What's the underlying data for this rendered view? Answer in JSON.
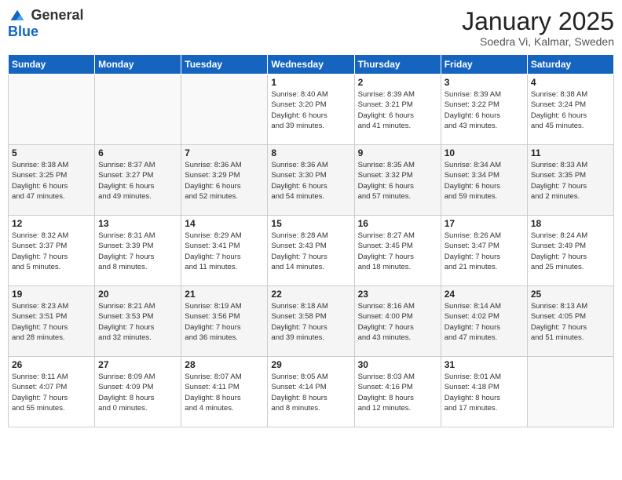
{
  "logo": {
    "general": "General",
    "blue": "Blue"
  },
  "title": "January 2025",
  "subtitle": "Soedra Vi, Kalmar, Sweden",
  "weekdays": [
    "Sunday",
    "Monday",
    "Tuesday",
    "Wednesday",
    "Thursday",
    "Friday",
    "Saturday"
  ],
  "weeks": [
    [
      {
        "day": "",
        "info": ""
      },
      {
        "day": "",
        "info": ""
      },
      {
        "day": "",
        "info": ""
      },
      {
        "day": "1",
        "info": "Sunrise: 8:40 AM\nSunset: 3:20 PM\nDaylight: 6 hours\nand 39 minutes."
      },
      {
        "day": "2",
        "info": "Sunrise: 8:39 AM\nSunset: 3:21 PM\nDaylight: 6 hours\nand 41 minutes."
      },
      {
        "day": "3",
        "info": "Sunrise: 8:39 AM\nSunset: 3:22 PM\nDaylight: 6 hours\nand 43 minutes."
      },
      {
        "day": "4",
        "info": "Sunrise: 8:38 AM\nSunset: 3:24 PM\nDaylight: 6 hours\nand 45 minutes."
      }
    ],
    [
      {
        "day": "5",
        "info": "Sunrise: 8:38 AM\nSunset: 3:25 PM\nDaylight: 6 hours\nand 47 minutes."
      },
      {
        "day": "6",
        "info": "Sunrise: 8:37 AM\nSunset: 3:27 PM\nDaylight: 6 hours\nand 49 minutes."
      },
      {
        "day": "7",
        "info": "Sunrise: 8:36 AM\nSunset: 3:29 PM\nDaylight: 6 hours\nand 52 minutes."
      },
      {
        "day": "8",
        "info": "Sunrise: 8:36 AM\nSunset: 3:30 PM\nDaylight: 6 hours\nand 54 minutes."
      },
      {
        "day": "9",
        "info": "Sunrise: 8:35 AM\nSunset: 3:32 PM\nDaylight: 6 hours\nand 57 minutes."
      },
      {
        "day": "10",
        "info": "Sunrise: 8:34 AM\nSunset: 3:34 PM\nDaylight: 6 hours\nand 59 minutes."
      },
      {
        "day": "11",
        "info": "Sunrise: 8:33 AM\nSunset: 3:35 PM\nDaylight: 7 hours\nand 2 minutes."
      }
    ],
    [
      {
        "day": "12",
        "info": "Sunrise: 8:32 AM\nSunset: 3:37 PM\nDaylight: 7 hours\nand 5 minutes."
      },
      {
        "day": "13",
        "info": "Sunrise: 8:31 AM\nSunset: 3:39 PM\nDaylight: 7 hours\nand 8 minutes."
      },
      {
        "day": "14",
        "info": "Sunrise: 8:29 AM\nSunset: 3:41 PM\nDaylight: 7 hours\nand 11 minutes."
      },
      {
        "day": "15",
        "info": "Sunrise: 8:28 AM\nSunset: 3:43 PM\nDaylight: 7 hours\nand 14 minutes."
      },
      {
        "day": "16",
        "info": "Sunrise: 8:27 AM\nSunset: 3:45 PM\nDaylight: 7 hours\nand 18 minutes."
      },
      {
        "day": "17",
        "info": "Sunrise: 8:26 AM\nSunset: 3:47 PM\nDaylight: 7 hours\nand 21 minutes."
      },
      {
        "day": "18",
        "info": "Sunrise: 8:24 AM\nSunset: 3:49 PM\nDaylight: 7 hours\nand 25 minutes."
      }
    ],
    [
      {
        "day": "19",
        "info": "Sunrise: 8:23 AM\nSunset: 3:51 PM\nDaylight: 7 hours\nand 28 minutes."
      },
      {
        "day": "20",
        "info": "Sunrise: 8:21 AM\nSunset: 3:53 PM\nDaylight: 7 hours\nand 32 minutes."
      },
      {
        "day": "21",
        "info": "Sunrise: 8:19 AM\nSunset: 3:56 PM\nDaylight: 7 hours\nand 36 minutes."
      },
      {
        "day": "22",
        "info": "Sunrise: 8:18 AM\nSunset: 3:58 PM\nDaylight: 7 hours\nand 39 minutes."
      },
      {
        "day": "23",
        "info": "Sunrise: 8:16 AM\nSunset: 4:00 PM\nDaylight: 7 hours\nand 43 minutes."
      },
      {
        "day": "24",
        "info": "Sunrise: 8:14 AM\nSunset: 4:02 PM\nDaylight: 7 hours\nand 47 minutes."
      },
      {
        "day": "25",
        "info": "Sunrise: 8:13 AM\nSunset: 4:05 PM\nDaylight: 7 hours\nand 51 minutes."
      }
    ],
    [
      {
        "day": "26",
        "info": "Sunrise: 8:11 AM\nSunset: 4:07 PM\nDaylight: 7 hours\nand 55 minutes."
      },
      {
        "day": "27",
        "info": "Sunrise: 8:09 AM\nSunset: 4:09 PM\nDaylight: 8 hours\nand 0 minutes."
      },
      {
        "day": "28",
        "info": "Sunrise: 8:07 AM\nSunset: 4:11 PM\nDaylight: 8 hours\nand 4 minutes."
      },
      {
        "day": "29",
        "info": "Sunrise: 8:05 AM\nSunset: 4:14 PM\nDaylight: 8 hours\nand 8 minutes."
      },
      {
        "day": "30",
        "info": "Sunrise: 8:03 AM\nSunset: 4:16 PM\nDaylight: 8 hours\nand 12 minutes."
      },
      {
        "day": "31",
        "info": "Sunrise: 8:01 AM\nSunset: 4:18 PM\nDaylight: 8 hours\nand 17 minutes."
      },
      {
        "day": "",
        "info": ""
      }
    ]
  ]
}
